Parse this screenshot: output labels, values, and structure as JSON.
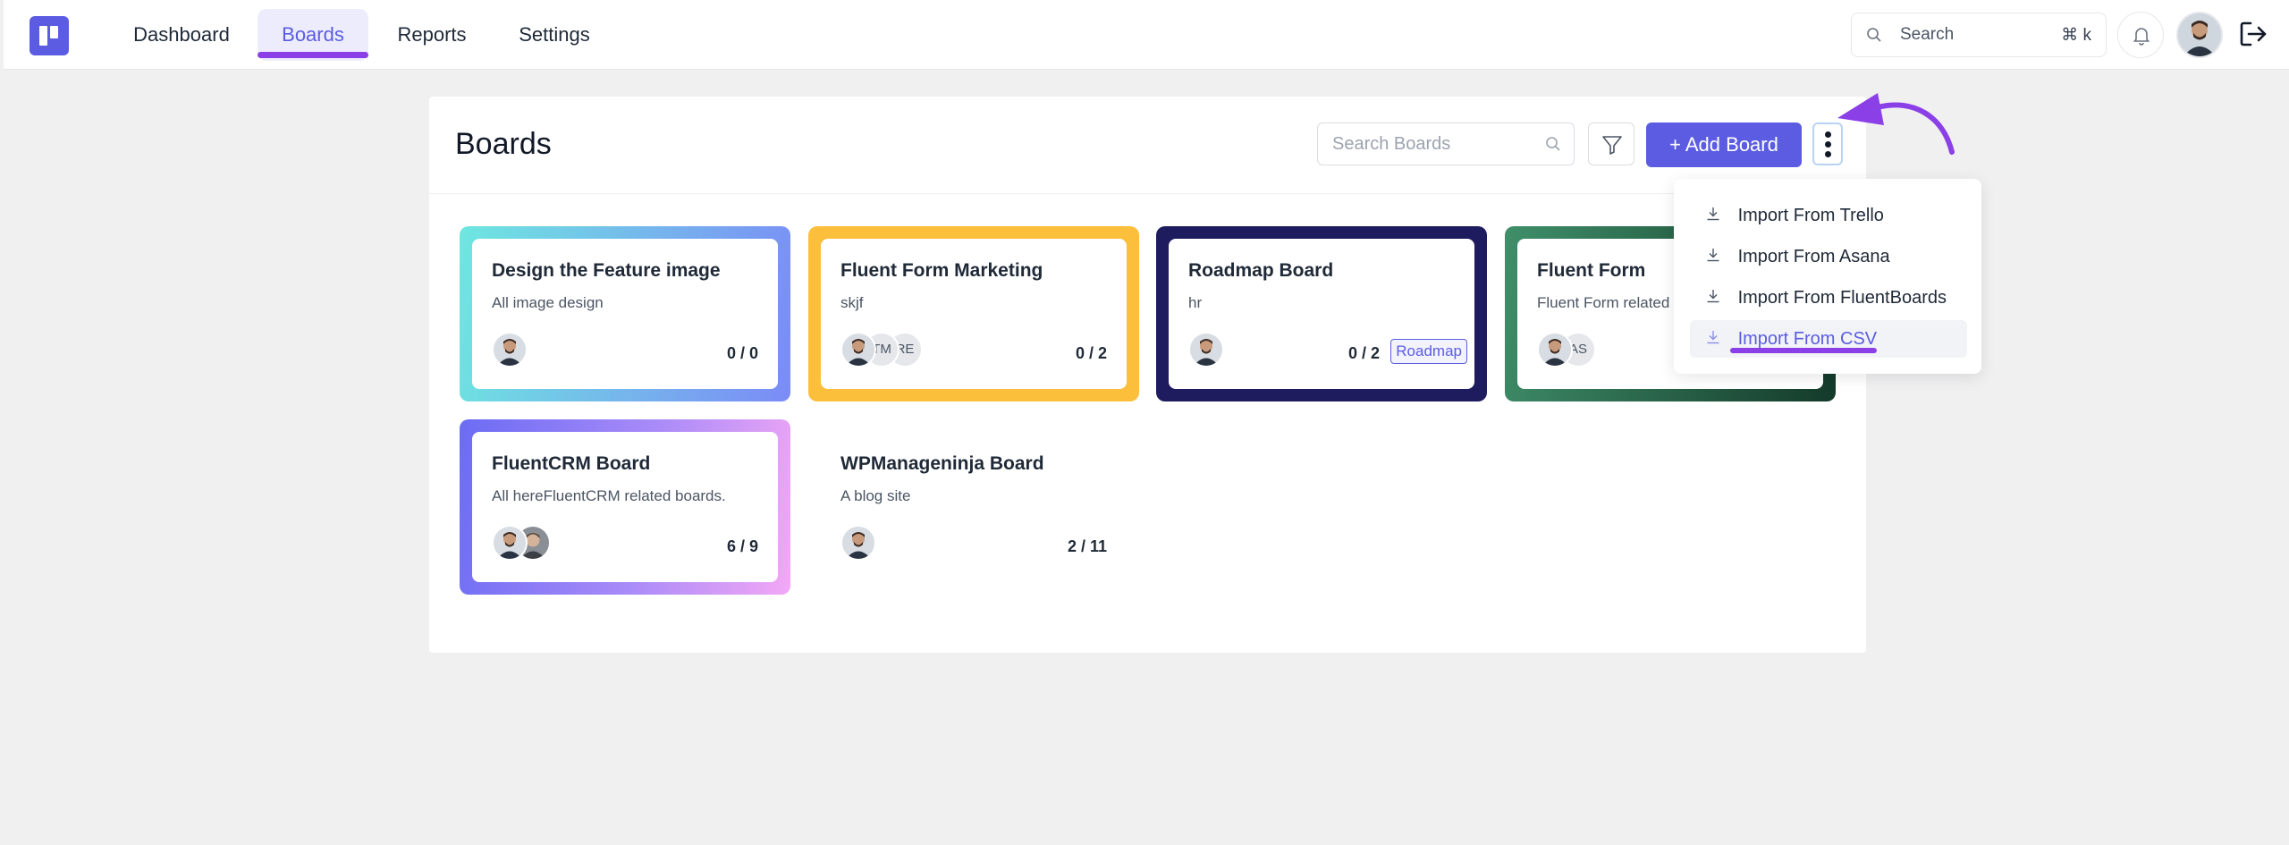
{
  "nav": {
    "items": [
      {
        "label": "Dashboard"
      },
      {
        "label": "Boards"
      },
      {
        "label": "Reports"
      },
      {
        "label": "Settings"
      }
    ],
    "active": "Boards"
  },
  "topbar": {
    "search_label": "Search",
    "search_shortcut": "⌘ k"
  },
  "page": {
    "title": "Boards",
    "search_placeholder": "Search Boards",
    "add_board_label": "+ Add Board"
  },
  "boards": [
    {
      "title": "Design the Feature image",
      "description": "All image design",
      "count": "0 / 0",
      "members": [],
      "accent": "#6ee7e0"
    },
    {
      "title": "Fluent Form Marketing",
      "description": "skjf",
      "count": "0 / 2",
      "members": [
        "TM",
        "RE"
      ],
      "accent": "#fbbf3c"
    },
    {
      "title": "Roadmap Board",
      "description": "hr",
      "count": "0 / 2",
      "tag": "Roadmap",
      "members": [],
      "accent": "#1e1b5e"
    },
    {
      "title": "Fluent Form",
      "description": "Fluent Form related",
      "count": "",
      "members": [
        "AS"
      ],
      "accent": "#2f7a5a"
    },
    {
      "title": "FluentCRM Board",
      "description": "All hereFluentCRM related boards.",
      "count": "6 / 9",
      "members": [],
      "accent": "#7b6cf6"
    },
    {
      "title": "WPManageninja Board",
      "description": "A blog site",
      "count": "2 / 11",
      "members": [],
      "accent": "#ffffff"
    }
  ],
  "import_menu": {
    "items": [
      {
        "label": "Import From Trello"
      },
      {
        "label": "Import From Asana"
      },
      {
        "label": "Import From FluentBoards"
      },
      {
        "label": "Import From CSV"
      }
    ],
    "highlighted": "Import From CSV"
  },
  "colors": {
    "brand": "#5b5ce2",
    "annotation": "#8b3fe6"
  }
}
